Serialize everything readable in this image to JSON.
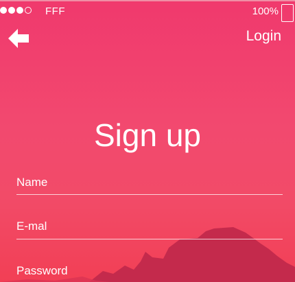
{
  "status_bar": {
    "carrier": "FFF",
    "battery_percent": "100%",
    "signal_bars_filled": 3,
    "signal_bars_total": 4
  },
  "header": {
    "back_icon": "back-arrow-icon",
    "login_label": "Login"
  },
  "main": {
    "title": "Sign up",
    "fields": [
      {
        "label": "Name"
      },
      {
        "label": "E-mal"
      },
      {
        "label": "Password"
      }
    ]
  },
  "colors": {
    "background_top": "#f0396d",
    "background_bottom": "#f23f55",
    "mountain": "#c42a4c",
    "text": "#ffffff"
  }
}
